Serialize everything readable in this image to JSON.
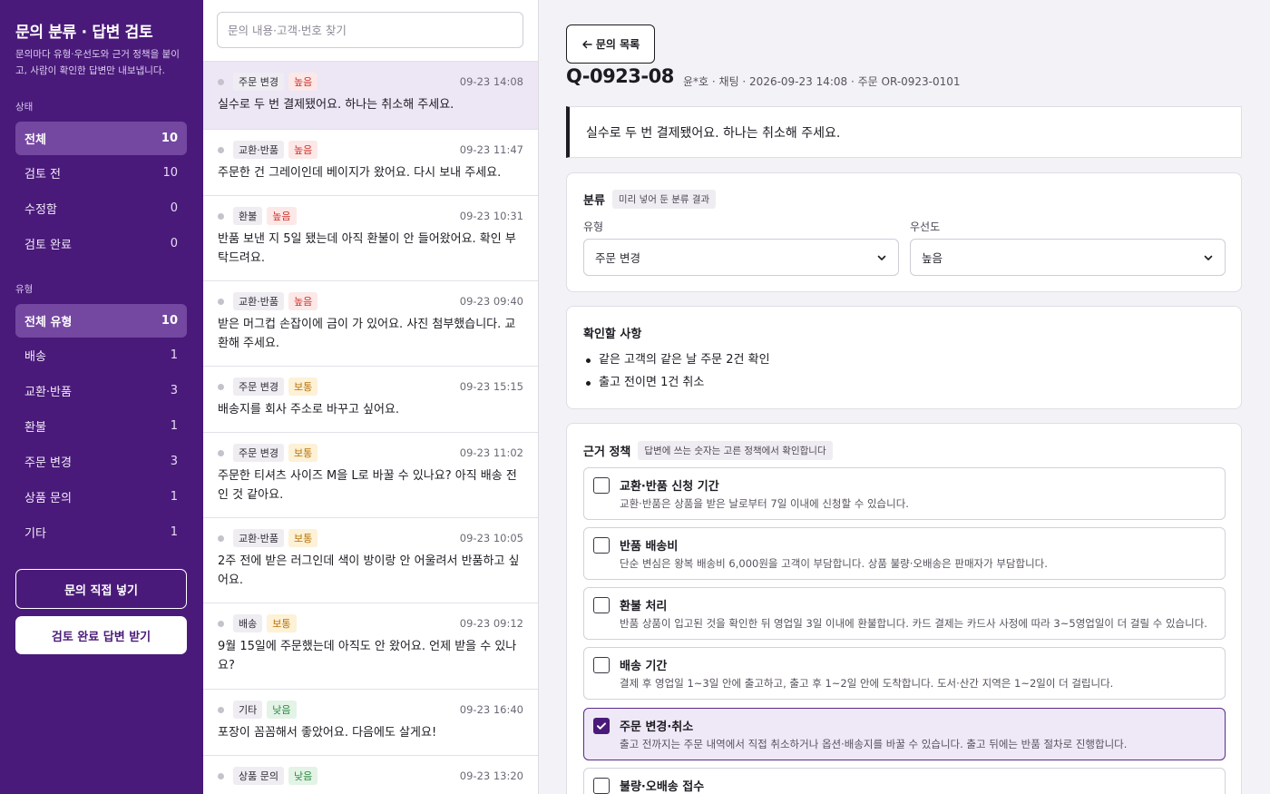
{
  "sidebar": {
    "title": "문의 분류 · 답변 검토",
    "description": "문의마다 유형·우선도와 근거 정책을 붙이고, 사람이 확인한 답변만 내보냅니다.",
    "status_label": "상태",
    "status_items": [
      {
        "label": "전체",
        "count": "10"
      },
      {
        "label": "검토 전",
        "count": "10"
      },
      {
        "label": "수정함",
        "count": "0"
      },
      {
        "label": "검토 완료",
        "count": "0"
      }
    ],
    "type_label": "유형",
    "type_items": [
      {
        "label": "전체 유형",
        "count": "10"
      },
      {
        "label": "배송",
        "count": "1"
      },
      {
        "label": "교환·반품",
        "count": "3"
      },
      {
        "label": "환불",
        "count": "1"
      },
      {
        "label": "주문 변경",
        "count": "3"
      },
      {
        "label": "상품 문의",
        "count": "1"
      },
      {
        "label": "기타",
        "count": "1"
      }
    ],
    "add_button": "문의 직접 넣기",
    "export_button": "검토 완료 답변 받기"
  },
  "search": {
    "placeholder": "문의 내용·고객·번호 찾기"
  },
  "inquiries": [
    {
      "type": "주문 변경",
      "priority": "높음",
      "time": "09-23 14:08",
      "text": "실수로 두 번 결제됐어요. 하나는 취소해 주세요."
    },
    {
      "type": "교환·반품",
      "priority": "높음",
      "time": "09-23 11:47",
      "text": "주문한 건 그레이인데 베이지가 왔어요. 다시 보내 주세요."
    },
    {
      "type": "환불",
      "priority": "높음",
      "time": "09-23 10:31",
      "text": "반품 보낸 지 5일 됐는데 아직 환불이 안 들어왔어요. 확인 부탁드려요."
    },
    {
      "type": "교환·반품",
      "priority": "높음",
      "time": "09-23 09:40",
      "text": "받은 머그컵 손잡이에 금이 가 있어요. 사진 첨부했습니다. 교환해 주세요."
    },
    {
      "type": "주문 변경",
      "priority": "보통",
      "time": "09-23 15:15",
      "text": "배송지를 회사 주소로 바꾸고 싶어요."
    },
    {
      "type": "주문 변경",
      "priority": "보통",
      "time": "09-23 11:02",
      "text": "주문한 티셔츠 사이즈 M을 L로 바꿀 수 있나요? 아직 배송 전인 것 같아요."
    },
    {
      "type": "교환·반품",
      "priority": "보통",
      "time": "09-23 10:05",
      "text": "2주 전에 받은 러그인데 색이 방이랑 안 어울려서 반품하고 싶어요."
    },
    {
      "type": "배송",
      "priority": "보통",
      "time": "09-23 09:12",
      "text": "9월 15일에 주문했는데 아직도 안 왔어요. 언제 받을 수 있나요?"
    },
    {
      "type": "기타",
      "priority": "낮음",
      "time": "09-23 16:40",
      "text": "포장이 꼼꼼해서 좋았어요. 다음에도 살게요!"
    },
    {
      "type": "상품 문의",
      "priority": "낮음",
      "time": "09-23 13:20",
      "text": ""
    }
  ],
  "detail": {
    "back_button": "문의 목록",
    "id": "Q-0923-08",
    "meta": "윤*호 · 채팅 · 2026-09-23 14:08 · 주문 OR-0923-0101",
    "message": "실수로 두 번 결제됐어요. 하나는 취소해 주세요.",
    "classification": {
      "title": "분류",
      "hint": "미리 넣어 둔 분류 결과",
      "type_label": "유형",
      "type_value": "주문 변경",
      "priority_label": "우선도",
      "priority_value": "높음"
    },
    "checks": {
      "title": "확인할 사항",
      "items": [
        "같은 고객의 같은 날 주문 2건 확인",
        "출고 전이면 1건 취소"
      ]
    },
    "policies": {
      "title": "근거 정책",
      "hint": "답변에 쓰는 숫자는 고른 정책에서 확인합니다",
      "items": [
        {
          "title": "교환·반품 신청 기간",
          "desc": "교환·반품은 상품을 받은 날로부터 7일 이내에 신청할 수 있습니다.",
          "checked": false
        },
        {
          "title": "반품 배송비",
          "desc": "단순 변심은 왕복 배송비 6,000원을 고객이 부담합니다. 상품 불량·오배송은 판매자가 부담합니다.",
          "checked": false
        },
        {
          "title": "환불 처리",
          "desc": "반품 상품이 입고된 것을 확인한 뒤 영업일 3일 이내에 환불합니다. 카드 결제는 카드사 사정에 따라 3~5영업일이 더 걸릴 수 있습니다.",
          "checked": false
        },
        {
          "title": "배송 기간",
          "desc": "결제 후 영업일 1~3일 안에 출고하고, 출고 후 1~2일 안에 도착합니다. 도서·산간 지역은 1~2일이 더 걸립니다.",
          "checked": false
        },
        {
          "title": "주문 변경·취소",
          "desc": "출고 전까지는 주문 내역에서 직접 취소하거나 옵션·배송지를 바꿀 수 있습니다. 출고 뒤에는 반품 절차로 진행합니다.",
          "checked": true
        },
        {
          "title": "불량·오배송 접수",
          "desc": "",
          "checked": false
        }
      ]
    }
  },
  "colors": {
    "sidebar_bg": "#4a1a7a",
    "accent": "#5a2a8c",
    "priority_high": "#d0342c",
    "priority_mid": "#b8730a",
    "priority_low": "#2e8a45"
  }
}
